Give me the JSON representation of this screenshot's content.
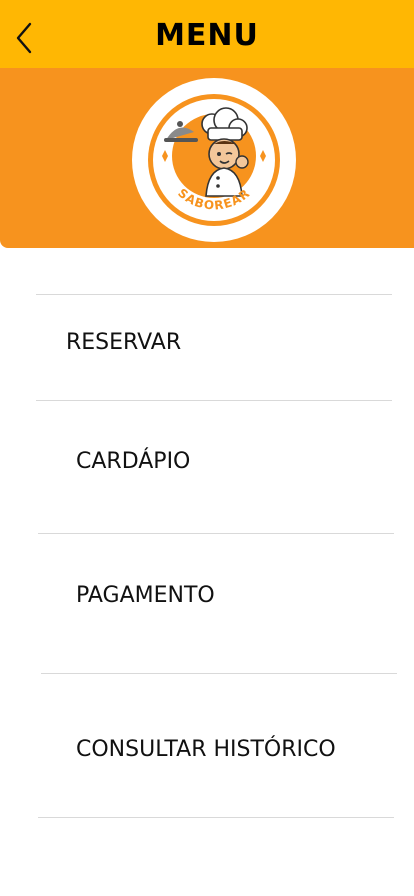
{
  "header": {
    "title": "MENU",
    "back_icon": "chevron-left-icon"
  },
  "logo": {
    "text": "SABOREAR",
    "icon": "chef-mascot-logo"
  },
  "menu": {
    "items": [
      {
        "label": "RESERVAR"
      },
      {
        "label": "CARDÁPIO"
      },
      {
        "label": "PAGAMENTO"
      },
      {
        "label": "CONSULTAR HISTÓRICO"
      }
    ]
  },
  "colors": {
    "topbar": "#FFB703",
    "hero": "#F7931E",
    "divider": "#d9d9d9"
  }
}
